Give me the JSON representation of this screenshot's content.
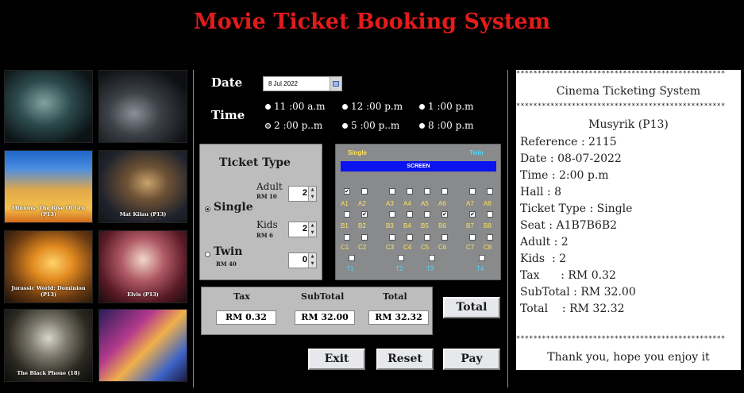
{
  "app_title": "Movie Ticket Booking System",
  "posters": [
    {
      "caption": ""
    },
    {
      "caption": ""
    },
    {
      "caption": "Minions: The Rise Of Gru (P13)"
    },
    {
      "caption": "Mat Kilau (P13)"
    },
    {
      "caption": "Jurassic World: Dominion (P13)"
    },
    {
      "caption": "Elvis (P13)"
    },
    {
      "caption": "The Black Phone (18)"
    },
    {
      "caption": ""
    }
  ],
  "date": {
    "label": "Date",
    "value": "8 Jul 2022"
  },
  "time": {
    "label": "Time",
    "options": [
      "11 :00 a.m",
      "12 :00 p.m",
      "1 :00 p.m",
      "2 :00 p..m",
      "5 :00 p..m",
      "8 :00 p.m"
    ],
    "selected": "2 :00 p..m"
  },
  "ticket": {
    "title": "Ticket Type",
    "single_label": "Single",
    "twin_label": "Twin",
    "adult_label": "Adult",
    "adult_price": "RM 10",
    "adult_qty": "2",
    "kids_label": "Kids",
    "kids_price": "RM 6",
    "kids_qty": "2",
    "twin_price": "RM 40",
    "twin_qty": "0",
    "selected": "Single"
  },
  "seats": {
    "single_label": "Single",
    "twin_label": "Twin",
    "screen_label": "SCREEN",
    "row1": {
      "labels": [
        "A1",
        "A2",
        "A3",
        "A4",
        "A5",
        "A6",
        "A7",
        "A8"
      ],
      "checked": [
        true,
        false,
        false,
        false,
        false,
        false,
        false,
        false
      ]
    },
    "row2": {
      "labels": [
        "B1",
        "B2",
        "B3",
        "B4",
        "B5",
        "B6",
        "B7",
        "B8"
      ],
      "checked": [
        false,
        true,
        false,
        false,
        false,
        true,
        true,
        false
      ]
    },
    "row3": {
      "labels": [
        "C1",
        "C2",
        "C3",
        "C4",
        "C5",
        "C6",
        "C7",
        "C8"
      ],
      "checked": [
        false,
        false,
        false,
        false,
        false,
        false,
        false,
        false
      ]
    },
    "twin": {
      "labels": [
        "T1",
        "T2",
        "T3",
        "T4"
      ],
      "checked": [
        false,
        false,
        false,
        false
      ]
    }
  },
  "summary": {
    "tax_label": "Tax",
    "tax": "RM 0.32",
    "subtotal_label": "SubTotal",
    "subtotal": "RM 32.00",
    "total_label": "Total",
    "total": "RM 32.32"
  },
  "buttons": {
    "total": "Total",
    "exit": "Exit",
    "reset": "Reset",
    "pay": "Pay"
  },
  "receipt": {
    "stars": "*************************************************",
    "heading": "Cinema Ticketing System",
    "movie": "Musyrik (P13)",
    "lines": [
      "Reference : 2115",
      "Date : 08-07-2022",
      "Time : 2:00 p.m",
      "Hall : 8",
      "Ticket Type : Single",
      "Seat : A1B7B6B2",
      "Adult : 2",
      "Kids  : 2",
      "Tax      : RM 0.32",
      "SubTotal : RM 32.00",
      "Total    : RM 32.32"
    ],
    "footer": "Thank you, hope you enjoy it"
  }
}
